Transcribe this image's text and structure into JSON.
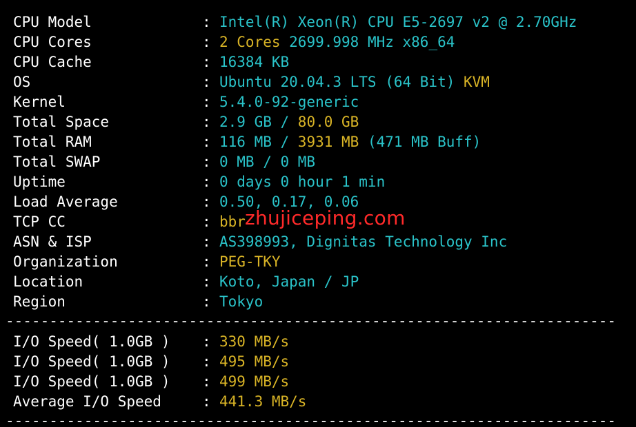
{
  "system_info": {
    "rows": [
      {
        "label": "CPU Model",
        "segments": [
          {
            "text": "Intel(R) Xeon(R) CPU E5-2697 v2 @ 2.70GHz",
            "color": "cyan"
          }
        ]
      },
      {
        "label": "CPU Cores",
        "segments": [
          {
            "text": "2 Cores",
            "color": "yellow"
          },
          {
            "text": " 2699.998 MHz x86_64",
            "color": "cyan"
          }
        ]
      },
      {
        "label": "CPU Cache",
        "segments": [
          {
            "text": "16384 KB",
            "color": "cyan"
          }
        ]
      },
      {
        "label": "OS",
        "segments": [
          {
            "text": "Ubuntu 20.04.3 LTS (64 Bit)",
            "color": "cyan"
          },
          {
            "text": " KVM",
            "color": "yellow"
          }
        ]
      },
      {
        "label": "Kernel",
        "segments": [
          {
            "text": "5.4.0-92-generic",
            "color": "cyan"
          }
        ]
      },
      {
        "label": "Total Space",
        "segments": [
          {
            "text": "2.9 GB / ",
            "color": "cyan"
          },
          {
            "text": "80.0 GB",
            "color": "yellow"
          }
        ]
      },
      {
        "label": "Total RAM",
        "segments": [
          {
            "text": "116 MB / ",
            "color": "cyan"
          },
          {
            "text": "3931 MB",
            "color": "yellow"
          },
          {
            "text": " (471 MB Buff)",
            "color": "cyan"
          }
        ]
      },
      {
        "label": "Total SWAP",
        "segments": [
          {
            "text": "0 MB / 0 MB",
            "color": "cyan"
          }
        ]
      },
      {
        "label": "Uptime",
        "segments": [
          {
            "text": "0 days 0 hour 1 min",
            "color": "cyan"
          }
        ]
      },
      {
        "label": "Load Average",
        "segments": [
          {
            "text": "0.50, 0.17, 0.06",
            "color": "cyan"
          }
        ]
      },
      {
        "label": "TCP CC",
        "segments": [
          {
            "text": "bbr",
            "color": "yellow"
          }
        ]
      },
      {
        "label": "ASN & ISP",
        "segments": [
          {
            "text": "AS398993, Dignitas Technology Inc",
            "color": "cyan"
          }
        ]
      },
      {
        "label": "Organization",
        "segments": [
          {
            "text": "PEG-TKY",
            "color": "yellow"
          }
        ]
      },
      {
        "label": "Location",
        "segments": [
          {
            "text": "Koto, Japan / JP",
            "color": "cyan"
          }
        ]
      },
      {
        "label": "Region",
        "segments": [
          {
            "text": "Tokyo",
            "color": "cyan"
          }
        ]
      }
    ]
  },
  "io_test": {
    "rows": [
      {
        "label": "I/O Speed( 1.0GB )",
        "segments": [
          {
            "text": "330 MB/s",
            "color": "yellow"
          }
        ]
      },
      {
        "label": "I/O Speed( 1.0GB )",
        "segments": [
          {
            "text": "495 MB/s",
            "color": "yellow"
          }
        ]
      },
      {
        "label": "I/O Speed( 1.0GB )",
        "segments": [
          {
            "text": "499 MB/s",
            "color": "yellow"
          }
        ]
      },
      {
        "label": "Average I/O Speed",
        "segments": [
          {
            "text": "441.3 MB/s",
            "color": "yellow"
          }
        ]
      }
    ]
  },
  "separator": ":",
  "divider_text": "----------------------------------------------------------------------",
  "watermark": "zhujiceping.com",
  "colors": {
    "background": "#000000",
    "label": "#ffffff",
    "cyan": "#2ac3c9",
    "yellow": "#d9b426",
    "watermark": "#ff2a2a"
  }
}
